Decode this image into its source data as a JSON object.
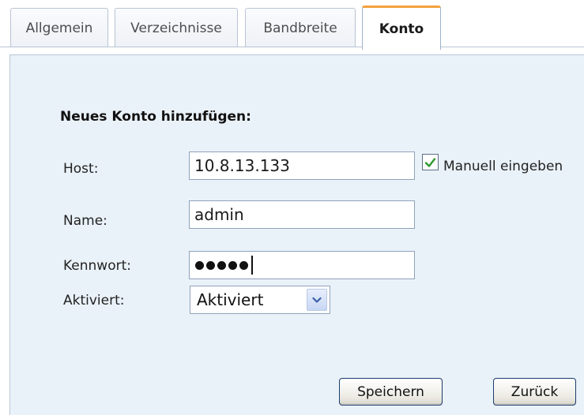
{
  "tabs": [
    {
      "label": "Allgemein"
    },
    {
      "label": "Verzeichnisse"
    },
    {
      "label": "Bandbreite"
    },
    {
      "label": "Konto"
    }
  ],
  "active_tab": "Konto",
  "form": {
    "title": "Neues Konto hinzufügen:",
    "host": {
      "label": "Host:",
      "value": "10.8.13.133"
    },
    "manual_entry": {
      "label": "Manuell eingeben",
      "checked": true
    },
    "name": {
      "label": "Name:",
      "value": "admin"
    },
    "password": {
      "label": "Kennwort:",
      "masked_length": 5
    },
    "activated": {
      "label": "Aktiviert:",
      "value": "Aktiviert"
    }
  },
  "buttons": {
    "save": "Speichern",
    "back": "Zurück"
  },
  "colors": {
    "panel_background": "#eaf2f9",
    "active_tab_accent": "#f2a23c",
    "checkmark": "#2e9b2e"
  },
  "icons": {
    "checkbox": "checkmark-icon",
    "select": "chevron-down-icon"
  }
}
